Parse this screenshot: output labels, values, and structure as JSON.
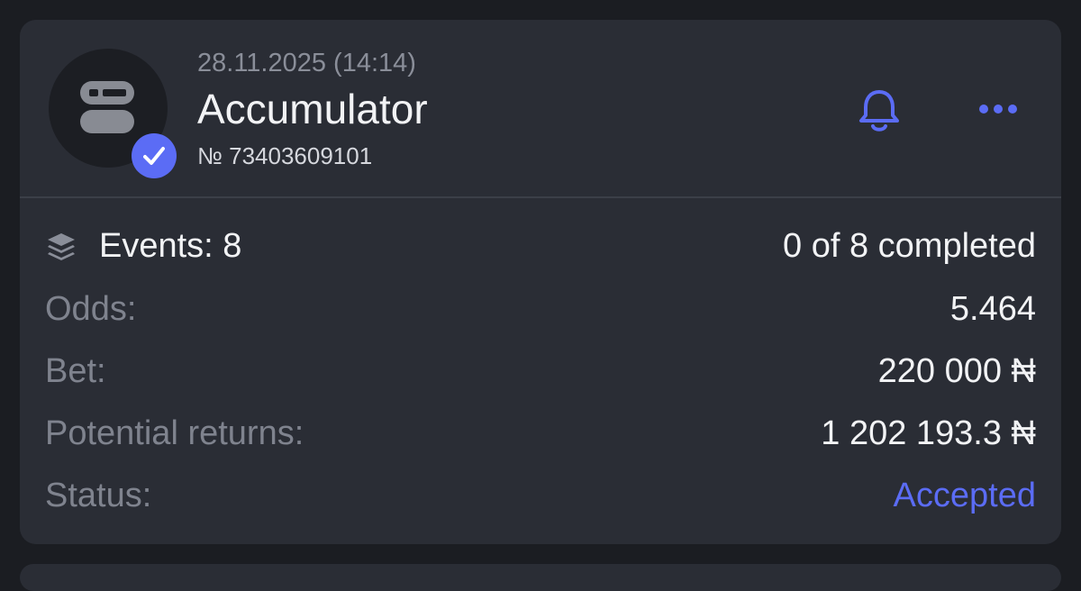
{
  "bet": {
    "date": "28.11.2025 (14:14)",
    "type": "Accumulator",
    "number": "№ 73403609101",
    "events_label": "Events: 8",
    "completed": "0 of 8 completed",
    "odds_label": "Odds:",
    "odds_value": "5.464",
    "bet_label": "Bet:",
    "bet_value": "220 000 ₦",
    "returns_label": "Potential returns:",
    "returns_value": "1 202 193.3 ₦",
    "status_label": "Status:",
    "status_value": "Accepted"
  },
  "icons": {
    "avatar": "accumulator-icon",
    "badge": "check-icon",
    "bell": "bell-icon",
    "more": "more-icon",
    "events": "layers-icon"
  },
  "colors": {
    "background": "#1b1d22",
    "card": "#2a2d35",
    "accent": "#5b6cf5",
    "text_primary": "#f2f3f5",
    "text_muted": "#7f838e"
  }
}
